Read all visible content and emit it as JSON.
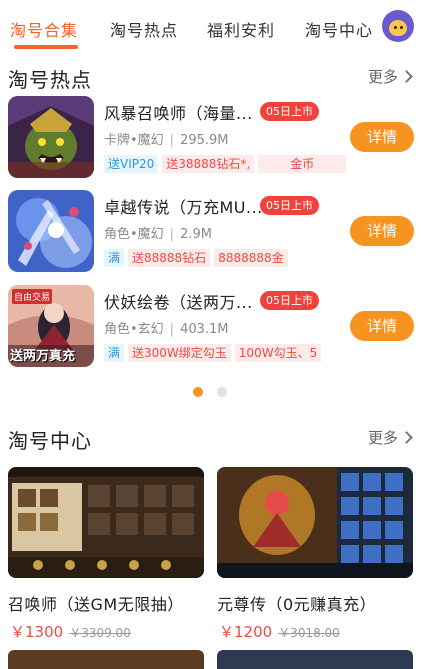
{
  "tabs": [
    {
      "label": "淘号合集",
      "active": true
    },
    {
      "label": "淘号热点",
      "active": false
    },
    {
      "label": "福利安利",
      "active": false
    },
    {
      "label": "淘号中心",
      "active": false
    }
  ],
  "hot_section": {
    "title": "淘号热点",
    "more_label": "更多",
    "games": [
      {
        "name": "风暴召唤师（海量...",
        "badge": "05日上市",
        "genre": "卡牌•魔幻",
        "size": "295.9M",
        "tags": [
          {
            "text": "送VIP20",
            "style": "blue"
          },
          {
            "text": "送38888钻石*,",
            "style": "pink"
          },
          {
            "text": "金币",
            "style": "pink"
          }
        ],
        "button_label": "详情"
      },
      {
        "name": "卓越传说（万充MU...",
        "badge": "05日上市",
        "genre": "角色•魔幻",
        "size": "2.9M",
        "tags": [
          {
            "text": "满",
            "style": "blue"
          },
          {
            "text": "送88888钻石",
            "style": "pink"
          },
          {
            "text": "8888888金",
            "style": "pink"
          }
        ],
        "button_label": "详情"
      },
      {
        "name": "伏妖绘卷（送两万...",
        "badge": "05日上市",
        "genre": "角色•玄幻",
        "size": "403.1M",
        "tags": [
          {
            "text": "满",
            "style": "blue"
          },
          {
            "text": "送300W绑定勾玉",
            "style": "pink"
          },
          {
            "text": "100W勾玉、5",
            "style": "pink"
          }
        ],
        "button_label": "详情",
        "thumb_text_top": "自由交易",
        "thumb_text_bottom": "送两万真充"
      }
    ],
    "pager": {
      "count": 2,
      "active": 0
    }
  },
  "center_section": {
    "title": "淘号中心",
    "more_label": "更多",
    "cards": [
      {
        "title": "召唤师（送GM无限抽）",
        "price": "￥1300",
        "original_price": "￥3309.00"
      },
      {
        "title": "元尊传（0元赚真充）",
        "price": "￥1200",
        "original_price": "￥3018.00"
      }
    ]
  },
  "colors": {
    "accent": "#f7622a",
    "button": "#f79320",
    "badge": "#f0423c",
    "price": "#ef4b43"
  }
}
